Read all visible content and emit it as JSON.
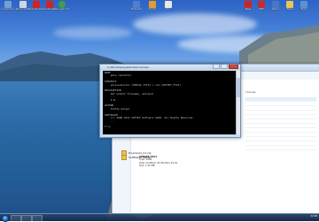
{
  "desktop": {
    "icons_left": [
      {
        "label": "Computer",
        "icon": "computer-icon",
        "color": "#6fa0d6"
      },
      {
        "label": "Recycle Bin",
        "icon": "recycle-bin-icon",
        "color": "#cfd7e2"
      },
      {
        "label": "Adobe Reader X",
        "icon": "pdf-icon",
        "color": "#d42222"
      },
      {
        "label": "Adobe Reader",
        "icon": "pdf-icon",
        "color": "#d42222"
      },
      {
        "label": "Google Chrome",
        "icon": "chrome-icon",
        "color": "#3f9e4a"
      }
    ],
    "icons_top_mid": [
      {
        "label": "Notepad",
        "icon": "notepad-icon",
        "color": "#4c7fd1"
      },
      {
        "label": "Paint",
        "icon": "paint-icon",
        "color": "#e89a2f"
      },
      {
        "label": "doc",
        "icon": "document-icon",
        "color": "#e8e8e8"
      }
    ],
    "icons_right": [
      {
        "label": "New",
        "icon": "pdf-icon",
        "color": "#d42222"
      },
      {
        "label": "PDF",
        "icon": "pdf-icon",
        "color": "#c82b2b"
      },
      {
        "label": "Setup",
        "icon": "installer-icon",
        "color": "#4a76c8"
      },
      {
        "label": "Files",
        "icon": "folder-icon",
        "color": "#e9c458"
      },
      {
        "label": "Tools",
        "icon": "folder-icon",
        "color": "#5f8fd0"
      }
    ]
  },
  "console": {
    "title": "C:\\Windows\\system32\\cmd.exe",
    "text": "NAME\n    pole connector\n\nSYNOPSIS\n    poleconnector [SERIAL_FILE] > con [OUTPUT_FILE]\n\nDESCRIPTION\n    Get output filename, optional\n    ...\n    Z.R.\n\nAUTHOR\n    Stefan Geiger\n\nCOPYRIGHT\n    (c) 2006-2011 SOFTEX Software GmbH. All Rights Reserved.\n    ...\n\nC:\\>"
  },
  "explorer": {
    "column_header": "Change",
    "file_items": [
      {
        "name": "Download_01.zip",
        "icon": "folder-icon"
      },
      {
        "name": "SoftMaker_Setup",
        "icon": "folder-icon"
      }
    ],
    "details": {
      "name": "UPDATE_2011",
      "type": "Type: 1069",
      "date_modified": "Date modified: 03.08.2011 22:01",
      "size": "Size: 1,43 MB"
    }
  },
  "taskbar": {
    "tray_time": "22:06",
    "tray_date": "03.08.2011"
  }
}
